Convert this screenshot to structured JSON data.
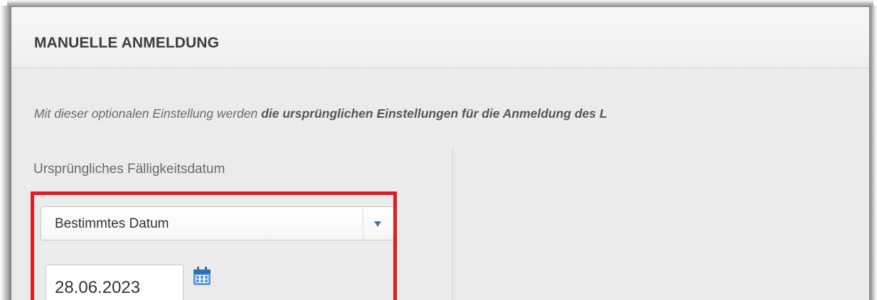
{
  "panel": {
    "title": "MANUELLE ANMELDUNG"
  },
  "intro": {
    "text_light": "Mit dieser optionalen Einstellung werden ",
    "text_bold": "die ursprünglichen Einstellungen für die Anmeldung des L"
  },
  "due_date": {
    "label": "Ursprüngliches Fälligkeitsdatum",
    "select_value": "Bestimmtes Datum",
    "date_value": "28.06.2023"
  },
  "icons": {
    "select_arrow": "chevron-down-icon",
    "calendar": "calendar-icon"
  },
  "colors": {
    "highlight": "#e51b24",
    "accent": "#3a78b0"
  }
}
